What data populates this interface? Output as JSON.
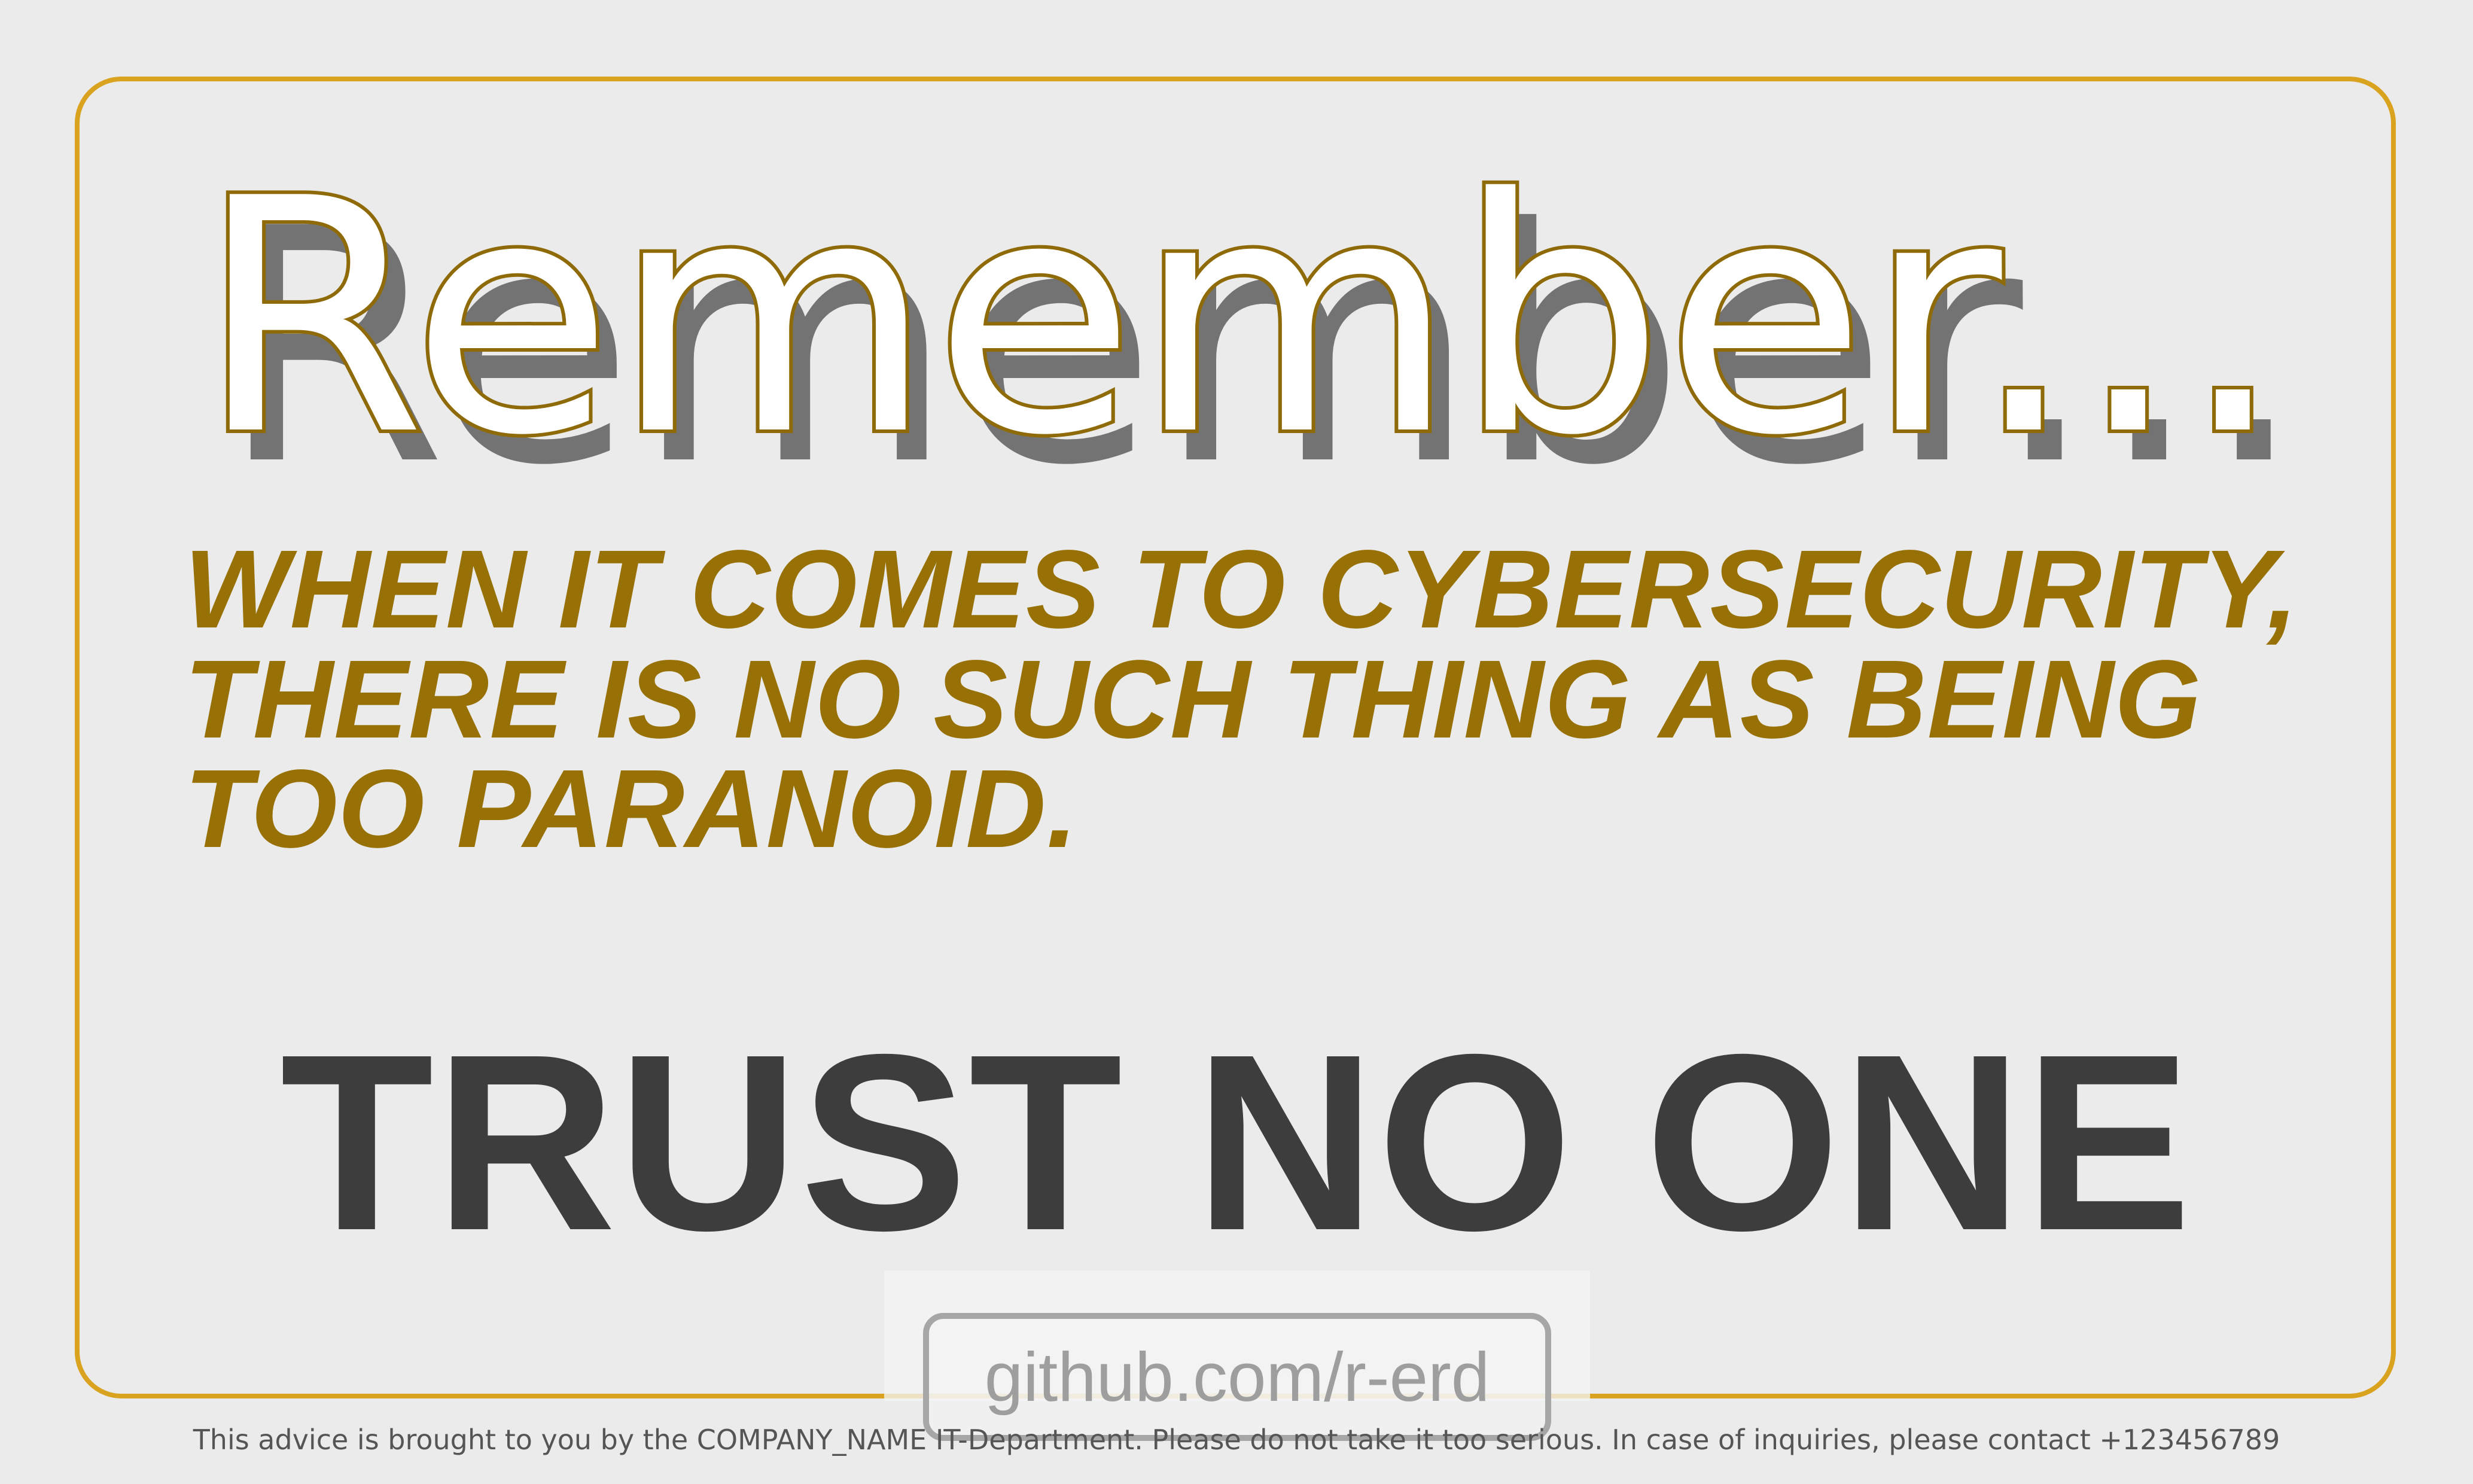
{
  "headline": "Remember...",
  "subtitle": {
    "line1": "WHEN IT COMES TO CYBERSECURITY,",
    "line2": "THERE IS NO SUCH THING AS BEING",
    "line3": "TOO PARANOID."
  },
  "main_text": "TRUST NO ONE",
  "credit": "github.com/r-erd",
  "footer": "This advice is brought to you by the COMPANY_NAME IT-Department. Please do not take it too serious. In case of inquiries, please contact +123456789",
  "colors": {
    "background": "#ebebeb",
    "frame_border": "#d9a21f",
    "headline_fill": "#ffffff",
    "headline_stroke": "#8f6a08",
    "headline_shadow": "#737373",
    "subtitle": "#987106",
    "main_text": "#3d3d3d",
    "credit_text": "#9e9e9e",
    "footer_text": "#555555"
  }
}
